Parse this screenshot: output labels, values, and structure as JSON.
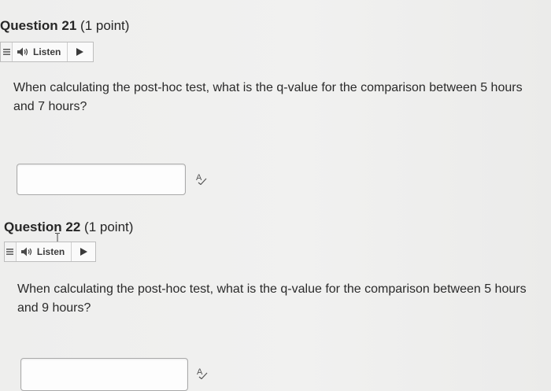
{
  "questions": [
    {
      "number_label": "Question 21",
      "points": "(1 point)",
      "listen_label": "Listen",
      "text": "When calculating the post-hoc test, what is the q-value for the comparison between 5 hours and 7 hours?",
      "answer_value": ""
    },
    {
      "number_label": "Question 22",
      "points": "(1 point)",
      "listen_label": "Listen",
      "text": "When calculating the post-hoc test, what is the q-value for the comparison between 5 hours and 9 hours?",
      "answer_value": ""
    }
  ],
  "icons": {
    "menu": "menu-icon",
    "speaker": "speaker-icon",
    "play": "play-icon",
    "spellcheck": "spellcheck-icon"
  }
}
